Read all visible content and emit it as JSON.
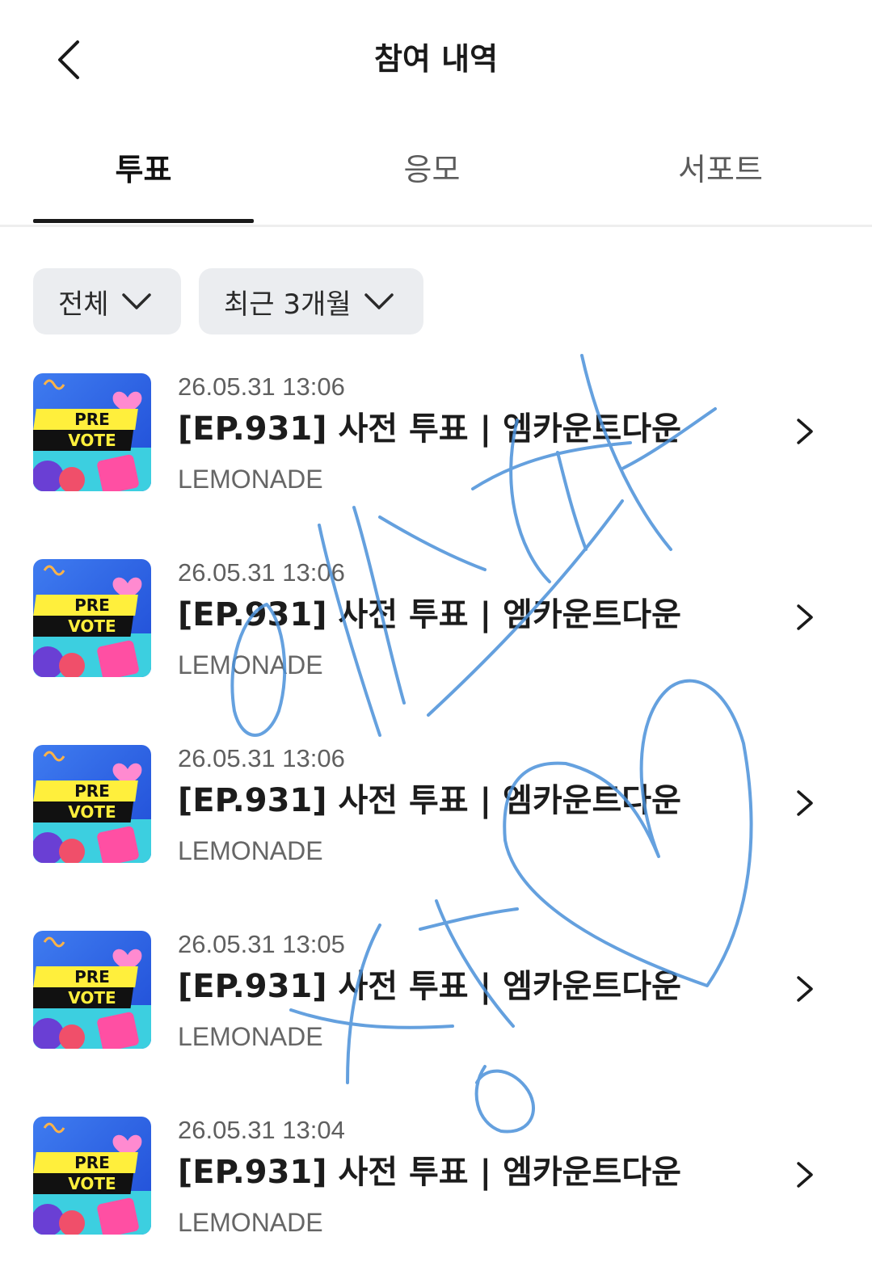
{
  "header": {
    "title": "참여 내역",
    "back_icon": "chevron-left-icon"
  },
  "tabs": [
    {
      "label": "투표",
      "active": true
    },
    {
      "label": "응모",
      "active": false
    },
    {
      "label": "서포트",
      "active": false
    }
  ],
  "filters": [
    {
      "label": "전체",
      "icon": "chevron-down-icon"
    },
    {
      "label": "최근 3개월",
      "icon": "chevron-down-icon"
    }
  ],
  "thumbnail": {
    "line1": "PRE",
    "line2": "VOTE"
  },
  "items": [
    {
      "time": "26.05.31 13:06",
      "title": "[EP.931] 사전 투표 | 엠카운트다운",
      "artist": "LEMONADE"
    },
    {
      "time": "26.05.31 13:06",
      "title": "[EP.931] 사전 투표 | 엠카운트다운",
      "artist": "LEMONADE"
    },
    {
      "time": "26.05.31 13:06",
      "title": "[EP.931] 사전 투표 | 엠카운트다운",
      "artist": "LEMONADE"
    },
    {
      "time": "26.05.31 13:05",
      "title": "[EP.931] 사전 투표 | 엠카운트다운",
      "artist": "LEMONADE"
    },
    {
      "time": "26.05.31 13:04",
      "title": "[EP.931] 사전 투표 | 엠카운트다운",
      "artist": "LEMONADE"
    }
  ],
  "colors": {
    "doodle": "#4a90d9",
    "accent": "#1a1a1a",
    "chip_bg": "#ebedf0"
  }
}
